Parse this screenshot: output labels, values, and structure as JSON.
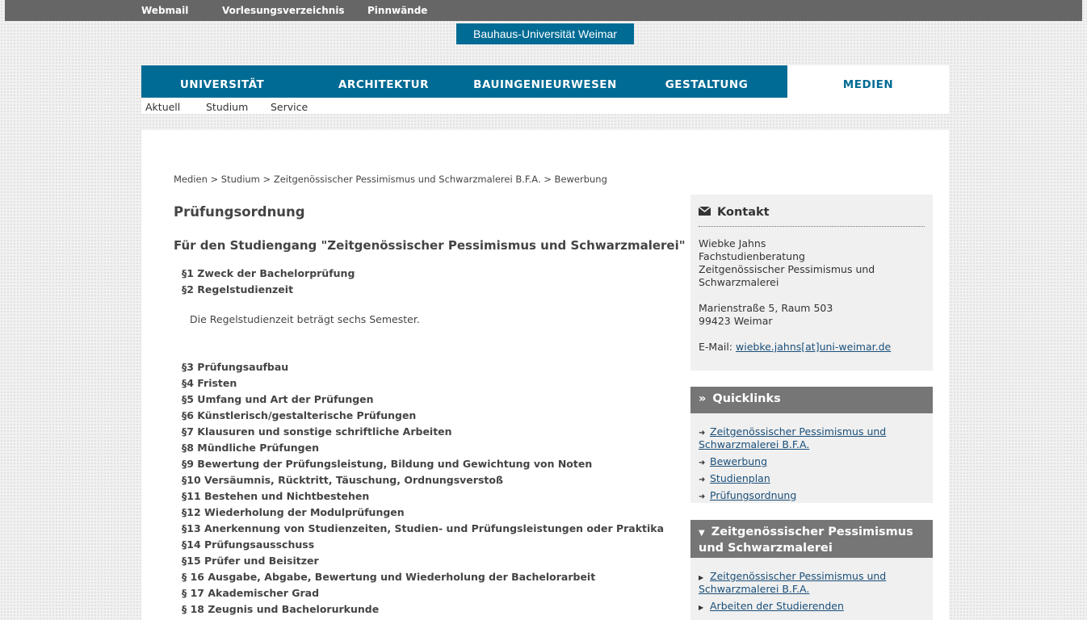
{
  "topbar": {
    "webmail": "Webmail",
    "vorlesungsverzeichnis": "Vorlesungsverzeichnis",
    "pinnwaende": "Pinnwände"
  },
  "logo": "Bauhaus-Universität Weimar",
  "mainnav": [
    "UNIVERSITÄT",
    "ARCHITEKTUR",
    "BAUINGENIEURWESEN",
    "GESTALTUNG",
    "MEDIEN"
  ],
  "subnav": [
    "Aktuell",
    "Studium",
    "Service"
  ],
  "breadcrumb": "Medien > Studium > Zeitgenössischer Pessimismus und Schwarzmalerei B.F.A. > Bewerbung",
  "heading": "Prüfungsordnung",
  "subheading": "Für den Studiengang \"Zeitgenössischer Pessimismus und Schwarzmalerei\"",
  "paragraphs_top": [
    "§1 Zweck der Bachelorprüfung",
    "§2 Regelstudienzeit"
  ],
  "regelstudienzeit_text": "Die Regelstudienzeit beträgt sechs Semester.",
  "paragraphs": [
    "§3 Prüfungsaufbau",
    "§4 Fristen",
    "§5 Umfang und Art der Prüfungen",
    "§6 Künstlerisch/gestalterische Prüfungen",
    "§7 Klausuren und sonstige schriftliche Arbeiten",
    "§8 Mündliche Prüfungen",
    "§9 Bewertung der Prüfungsleistung, Bildung und Gewichtung von Noten",
    "§10 Versäumnis, Rücktritt, Täuschung, Ordnungsverstoß",
    "§11 Bestehen und Nichtbestehen",
    "§12 Wiederholung der Modulprüfungen",
    "§13 Anerkennung von Studienzeiten, Studien- und Prüfungsleistungen oder Praktika",
    "§14 Prüfungsausschuss",
    "§15 Prüfer und Beisitzer",
    "§ 16 Ausgabe, Abgabe, Bewertung und Wiederholung der Bachelorarbeit",
    "§ 17 Akademischer Grad",
    "§ 18 Zeugnis und Bachelorurkunde"
  ],
  "contact": {
    "title": "Kontakt",
    "name": "Wiebke Jahns",
    "role": "Fachstudienberatung",
    "program_line1": "Zeitgenössischer Pessimismus und",
    "program_line2": "Schwarzmalerei",
    "street": "Marienstraße 5, Raum 503",
    "city": "99423 Weimar",
    "email_label": "E-Mail:",
    "email": "wiebke.jahns[at]uni-weimar.de"
  },
  "quicklinks": {
    "title": "Quicklinks",
    "items": [
      "Zeitgenössischer Pessimismus und",
      "Schwarzmalerei B.F.A.",
      "Bewerbung",
      "Studienplan",
      "Prüfungsordnung"
    ]
  },
  "program_box": {
    "title_line1": "Zeitgenössischer Pessimismus",
    "title_line2": "und Schwarzmalerei",
    "items": [
      "Zeitgenössischer Pessimismus und",
      "Schwarzmalerei B.F.A.",
      "Arbeiten der Studierenden"
    ]
  }
}
